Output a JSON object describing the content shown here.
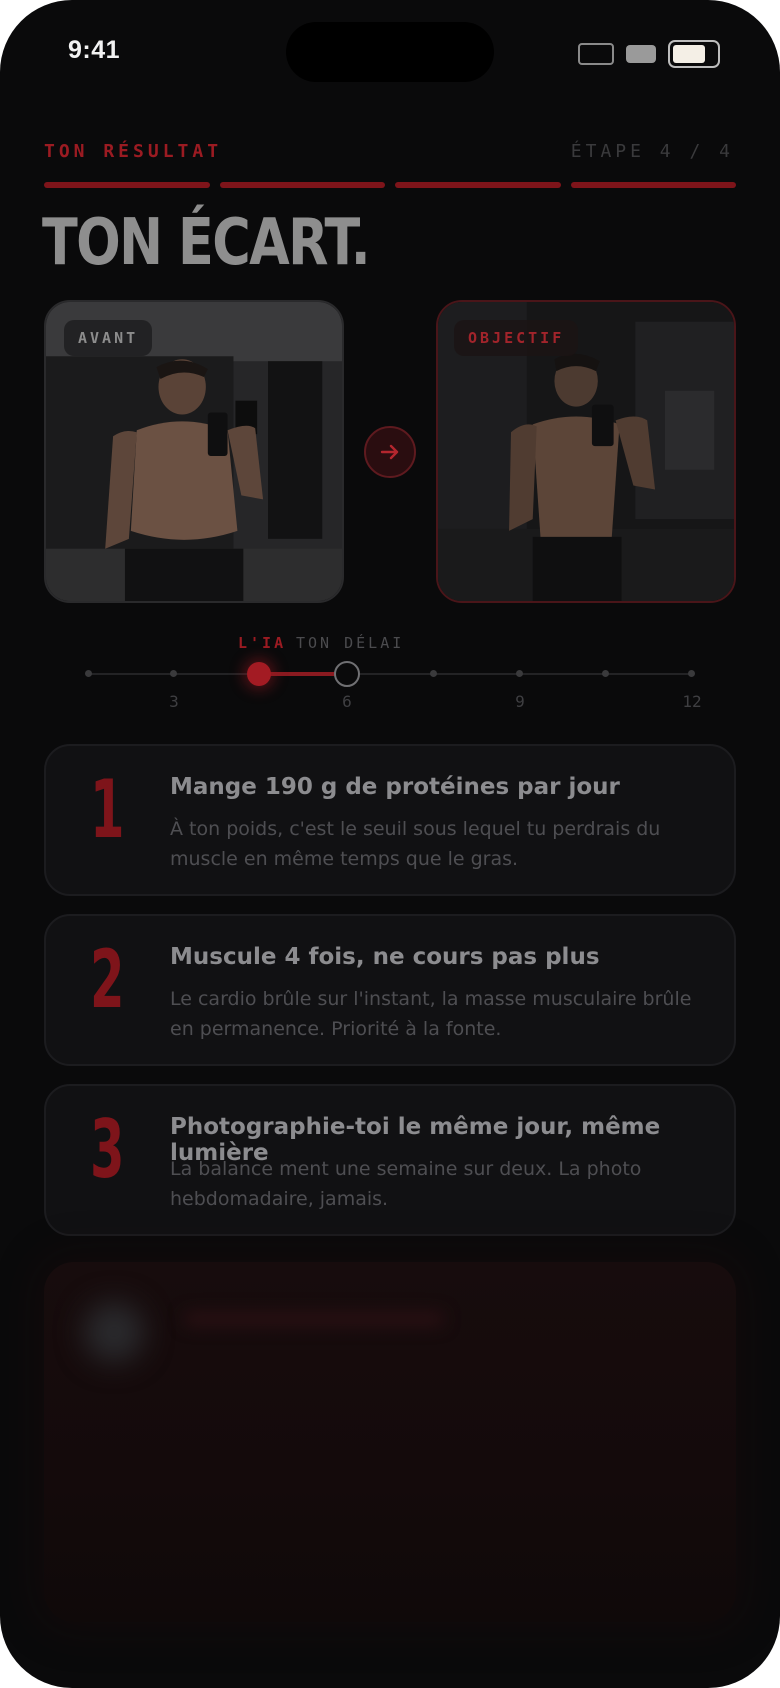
{
  "status_bar": {
    "time": "9:41"
  },
  "header": {
    "step_label": "TON RÉSULTAT",
    "step_counter": "ÉTAPE 4 / 4",
    "progress_segments_filled": 4,
    "progress_segments_total": 4
  },
  "title": "TON ÉCART.",
  "photos": {
    "before_label": "AVANT",
    "after_label": "OBJECTIF",
    "arrow_icon": "arrow-right-icon"
  },
  "timeline": {
    "ai_label": "L'IA",
    "you_label": "TON DÉLAI",
    "ticks": [
      "3",
      "6",
      "9",
      "12"
    ],
    "ai_value": 4,
    "your_value": 6
  },
  "tips": [
    {
      "number": "1",
      "title": "Mange 190 g de protéines par jour",
      "description": "À ton poids, c'est le seuil sous lequel tu perdrais du muscle en même temps que le gras."
    },
    {
      "number": "2",
      "title": "Muscule 4 fois, ne cours pas plus",
      "description": "Le cardio brûle sur l'instant, la masse musculaire brûle en permanence. Priorité à la fonte."
    },
    {
      "number": "3",
      "title": "Photographie-toi le même jour, même lumière",
      "description": "La balance ment une semaine sur deux. La photo hebdomadaire, jamais."
    }
  ],
  "colors": {
    "accent": "#9b1b22",
    "background": "#0a0a0b",
    "card": "#111113"
  }
}
